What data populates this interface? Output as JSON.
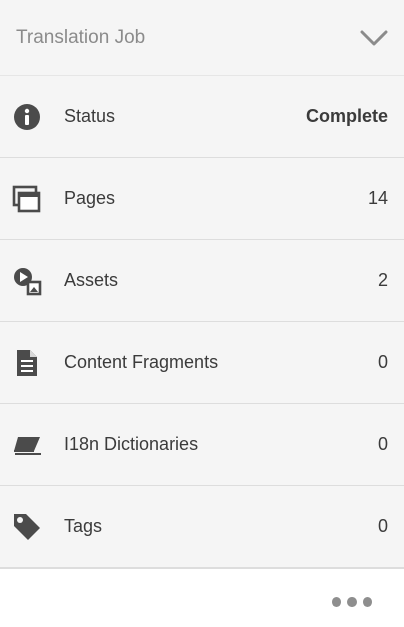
{
  "header": {
    "title": "Translation Job"
  },
  "rows": [
    {
      "icon": "info-icon",
      "label": "Status",
      "value": "Complete"
    },
    {
      "icon": "pages-icon",
      "label": "Pages",
      "value": "14"
    },
    {
      "icon": "assets-icon",
      "label": "Assets",
      "value": "2"
    },
    {
      "icon": "document-icon",
      "label": "Content Fragments",
      "value": "0"
    },
    {
      "icon": "eraser-icon",
      "label": "I18n Dictionaries",
      "value": "0"
    },
    {
      "icon": "tag-icon",
      "label": "Tags",
      "value": "0"
    }
  ],
  "footer": {
    "more_icon": "more-icon"
  }
}
